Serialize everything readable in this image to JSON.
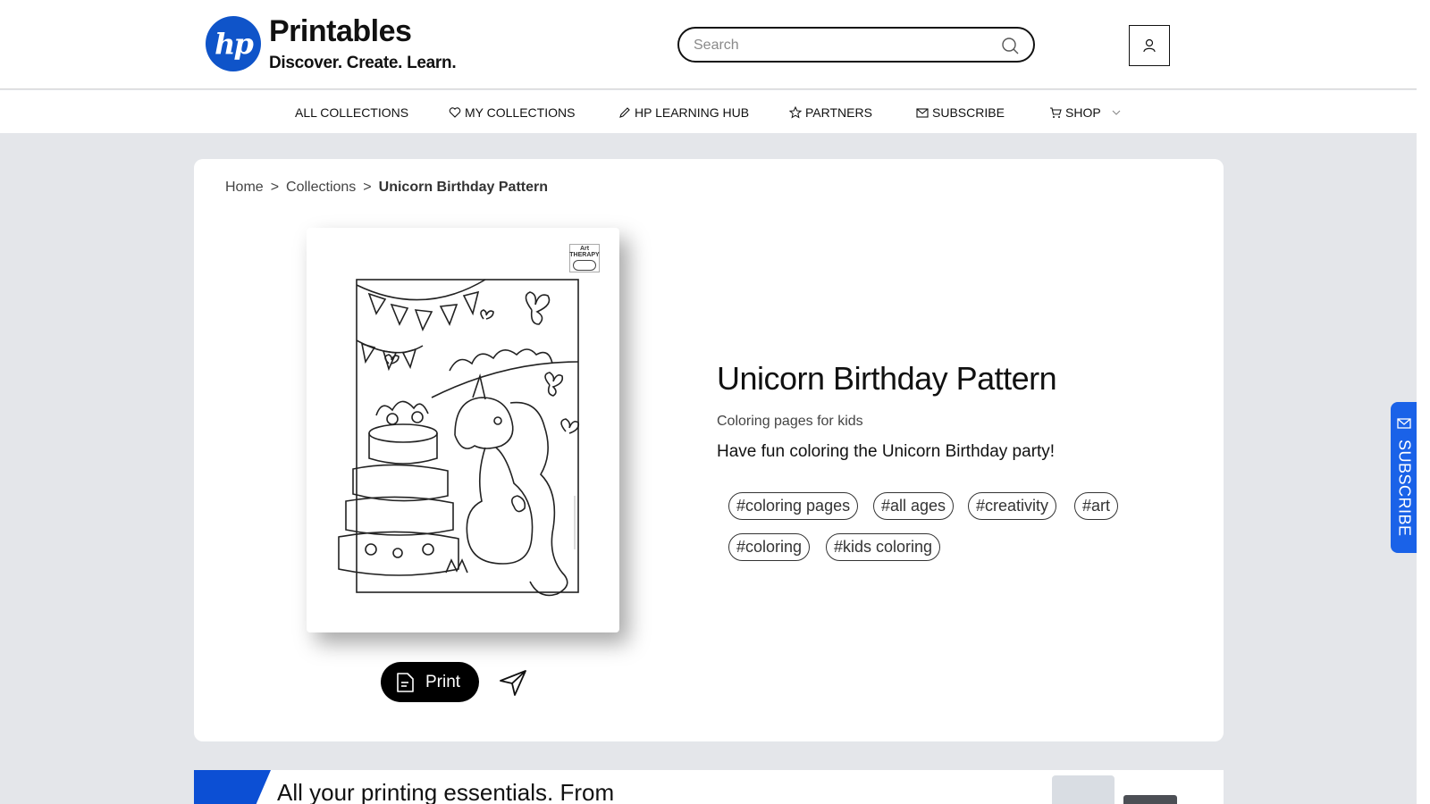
{
  "brand": {
    "logo_text": "hp",
    "title": "Printables",
    "tagline": "Discover. Create. Learn."
  },
  "search": {
    "placeholder": "Search"
  },
  "nav": {
    "items": [
      {
        "label": "ALL COLLECTIONS",
        "icon": ""
      },
      {
        "label": "MY COLLECTIONS",
        "icon": "heart-icon"
      },
      {
        "label": "HP LEARNING HUB",
        "icon": "pencil-icon"
      },
      {
        "label": "PARTNERS",
        "icon": "star-icon"
      },
      {
        "label": "SUBSCRIBE",
        "icon": "mail-icon"
      },
      {
        "label": "SHOP",
        "icon": "cart-icon"
      }
    ]
  },
  "breadcrumb": {
    "home": "Home",
    "collections": "Collections",
    "current": "Unicorn Birthday Pattern",
    "separator": ">"
  },
  "preview": {
    "badge_line1": "Art",
    "badge_line2": "THERAPY"
  },
  "actions": {
    "print_label": "Print"
  },
  "product": {
    "title": "Unicorn Birthday Pattern",
    "subtitle": "Coloring pages for kids",
    "description": "Have fun coloring the Unicorn Birthday party!",
    "tags": [
      "#coloring pages",
      "#all ages",
      "#creativity",
      "#art",
      "#coloring",
      "#kids coloring"
    ]
  },
  "side_subscribe": {
    "label": "SUBSCRIBE"
  },
  "promo": {
    "text": "All your printing essentials. From"
  },
  "colors": {
    "brand_blue": "#0f54c9",
    "subscribe_blue": "#1a62e8",
    "page_bg": "#e4e6ea"
  }
}
